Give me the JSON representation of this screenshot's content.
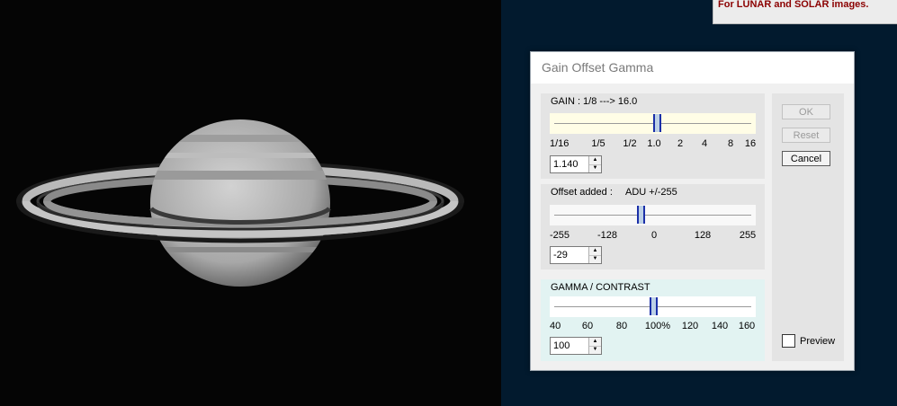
{
  "tooltip": {
    "text": "For LUNAR and SOLAR images."
  },
  "dialog": {
    "title": "Gain Offset Gamma",
    "gain": {
      "label": "GAIN :  1/8   --->   16.0",
      "ticks": [
        "1/16",
        "1/5",
        "1/2",
        "1.0",
        "2",
        "4",
        "8",
        "16"
      ],
      "value": "1.140"
    },
    "offset": {
      "label": "Offset added :",
      "label2": "ADU +/-255",
      "ticks": [
        "-255",
        "-128",
        "0",
        "128",
        "255"
      ],
      "value": "-29"
    },
    "gamma": {
      "label": "GAMMA / CONTRAST",
      "ticks": [
        "40",
        "60",
        "80",
        "100%",
        "120",
        "140",
        "160"
      ],
      "value": "100"
    },
    "buttons": {
      "ok": "OK",
      "reset": "Reset",
      "cancel": "Cancel"
    },
    "preview": {
      "label": "Preview",
      "checked": false
    }
  }
}
